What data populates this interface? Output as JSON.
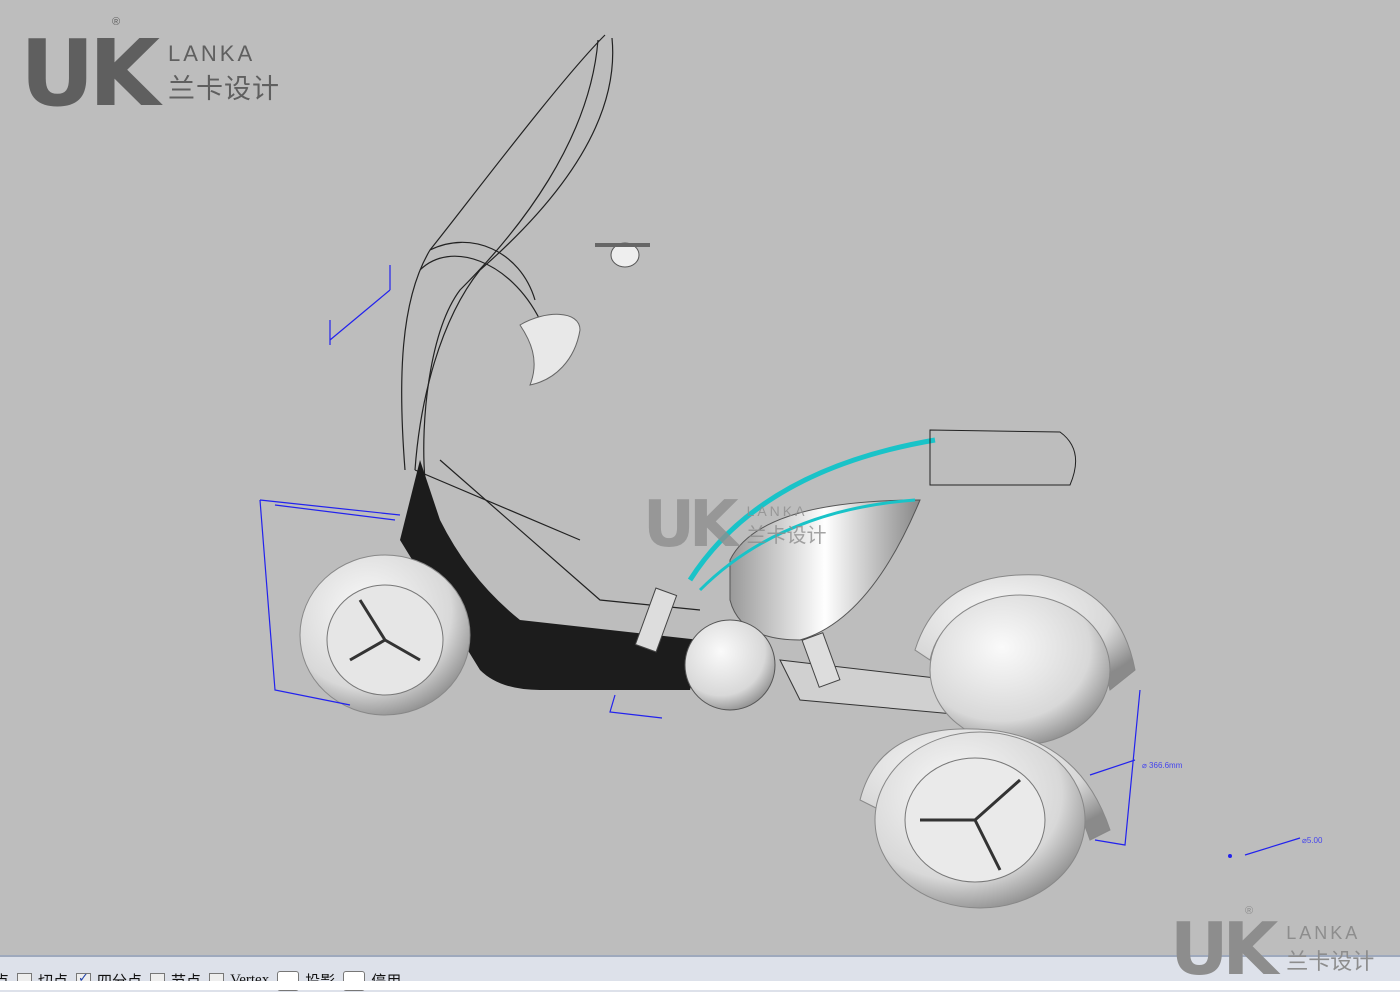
{
  "watermark": {
    "mark": "UK",
    "brand_en": "LANKA",
    "brand_cn": "兰卡设计",
    "registered": "®"
  },
  "viewport": {
    "dimensions": [
      "⌀ 366.6mm",
      "⌀5.00"
    ],
    "colors": {
      "background": "#bdbdbd",
      "dimension": "#2222ee",
      "highlight_curve": "#19c3c8",
      "body": "#1c1c1c"
    }
  },
  "osnap_bar": {
    "items": [
      {
        "label": "点",
        "checked": false
      },
      {
        "label": "切点",
        "checked": false
      },
      {
        "label": "四分点",
        "checked": true
      },
      {
        "label": "节点",
        "checked": false
      },
      {
        "label": "Vertex",
        "checked": false
      },
      {
        "label": "投影",
        "checked": false
      },
      {
        "label": "停用",
        "checked": false
      }
    ]
  }
}
